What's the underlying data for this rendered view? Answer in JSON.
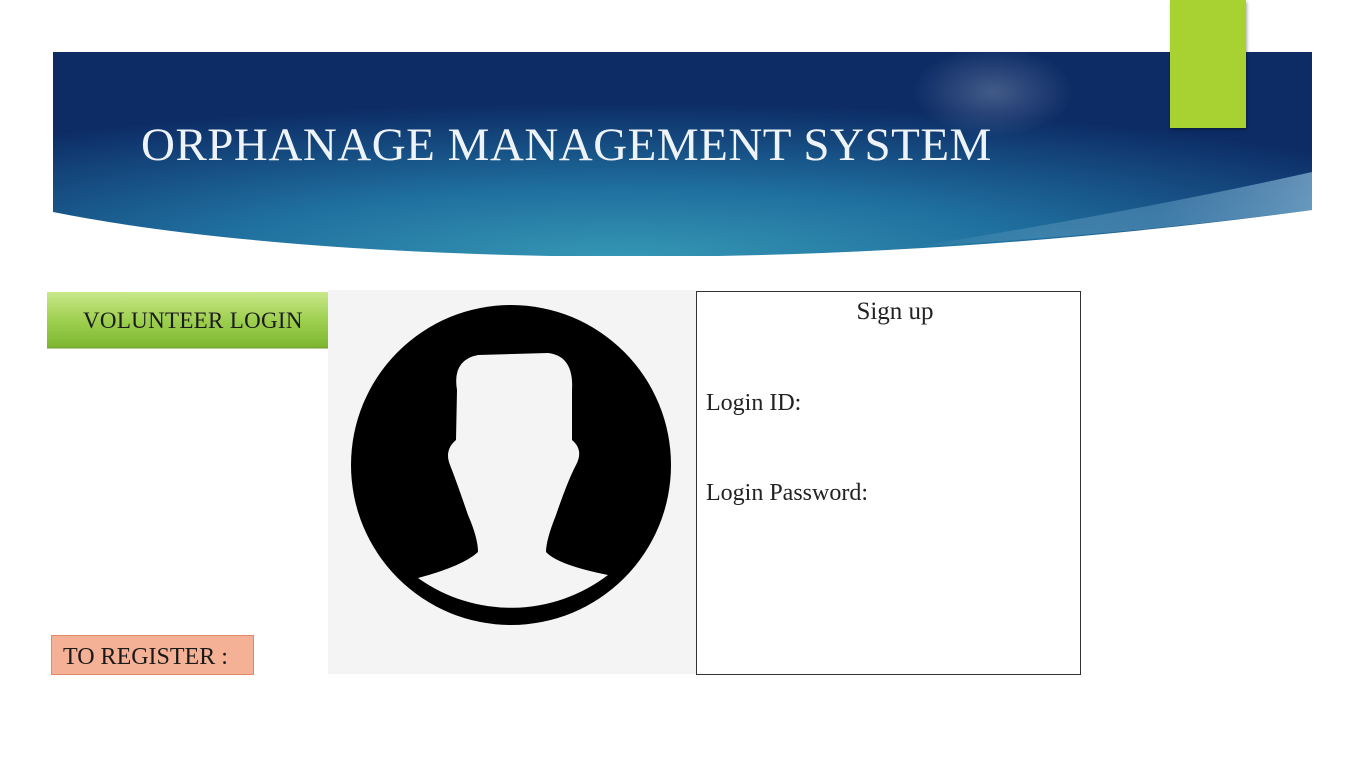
{
  "header": {
    "title": "ORPHANAGE MANAGEMENT SYSTEM"
  },
  "volunteer": {
    "label": "VOLUNTEER LOGIN"
  },
  "signup": {
    "title": "Sign up",
    "login_id_label": "Login ID:",
    "login_password_label": "Login Password:",
    "login_id_value": "",
    "login_password_value": ""
  },
  "register": {
    "label": "TO REGISTER :"
  },
  "icons": {
    "avatar": "user-silhouette-icon"
  },
  "colors": {
    "banner_dark": "#0e2f6a",
    "banner_light": "#2a8fb0",
    "accent_green": "#a7d232",
    "register_fill": "#f4b195",
    "volunteer_fill": "#8dc63f"
  }
}
